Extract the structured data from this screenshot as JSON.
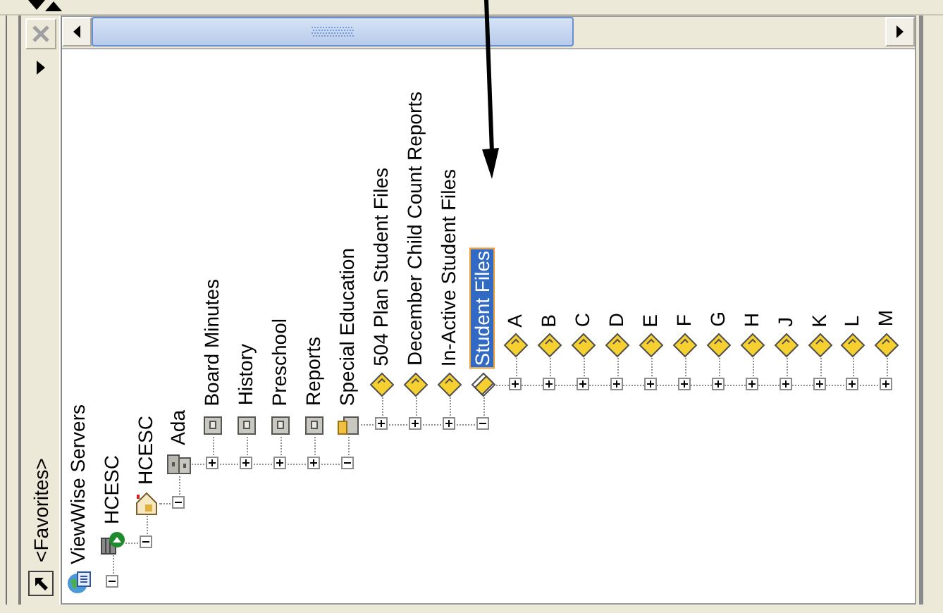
{
  "sidebar": {
    "close_button": {
      "disabled": true
    },
    "title": "<Favorites>"
  },
  "tree": [
    {
      "label": "ViewWise Servers",
      "kind": "globe",
      "selected": false,
      "children": [
        {
          "label": "HCESC",
          "kind": "server",
          "expanded": true,
          "selected": false,
          "children": [
            {
              "label": "HCESC",
              "kind": "site",
              "expanded": true,
              "selected": false,
              "children": [
                {
                  "label": "Ada",
                  "kind": "cabinet",
                  "expanded": true,
                  "selected": false,
                  "children": [
                    {
                      "label": "Board Minutes",
                      "kind": "drawer",
                      "expanded": false,
                      "selected": false
                    },
                    {
                      "label": "History",
                      "kind": "drawer",
                      "expanded": false,
                      "selected": false
                    },
                    {
                      "label": "Preschool",
                      "kind": "drawer",
                      "expanded": false,
                      "selected": false
                    },
                    {
                      "label": "Reports",
                      "kind": "drawer",
                      "expanded": false,
                      "selected": false
                    },
                    {
                      "label": "Special Education",
                      "kind": "open-drawer",
                      "expanded": true,
                      "selected": false,
                      "children": [
                        {
                          "label": "504 Plan Student Files",
                          "kind": "folder",
                          "expanded": false,
                          "selected": false
                        },
                        {
                          "label": "December Child Count Reports",
                          "kind": "folder",
                          "expanded": false,
                          "selected": false
                        },
                        {
                          "label": "In-Active Student Files",
                          "kind": "folder",
                          "expanded": false,
                          "selected": false
                        },
                        {
                          "label": "Student Files",
                          "kind": "open-folder",
                          "expanded": true,
                          "selected": true,
                          "children": [
                            {
                              "label": "A",
                              "kind": "folder",
                              "expanded": false,
                              "selected": false
                            },
                            {
                              "label": "B",
                              "kind": "folder",
                              "expanded": false,
                              "selected": false
                            },
                            {
                              "label": "C",
                              "kind": "folder",
                              "expanded": false,
                              "selected": false
                            },
                            {
                              "label": "D",
                              "kind": "folder",
                              "expanded": false,
                              "selected": false
                            },
                            {
                              "label": "E",
                              "kind": "folder",
                              "expanded": false,
                              "selected": false
                            },
                            {
                              "label": "F",
                              "kind": "folder",
                              "expanded": false,
                              "selected": false
                            },
                            {
                              "label": "G",
                              "kind": "folder",
                              "expanded": false,
                              "selected": false
                            },
                            {
                              "label": "H",
                              "kind": "folder",
                              "expanded": false,
                              "selected": false
                            },
                            {
                              "label": "J",
                              "kind": "folder",
                              "expanded": false,
                              "selected": false
                            },
                            {
                              "label": "K",
                              "kind": "folder",
                              "expanded": false,
                              "selected": false
                            },
                            {
                              "label": "L",
                              "kind": "folder",
                              "expanded": false,
                              "selected": false
                            },
                            {
                              "label": "M",
                              "kind": "folder",
                              "expanded": false,
                              "selected": false
                            }
                          ]
                        }
                      ]
                    }
                  ]
                }
              ]
            }
          ]
        }
      ]
    }
  ]
}
